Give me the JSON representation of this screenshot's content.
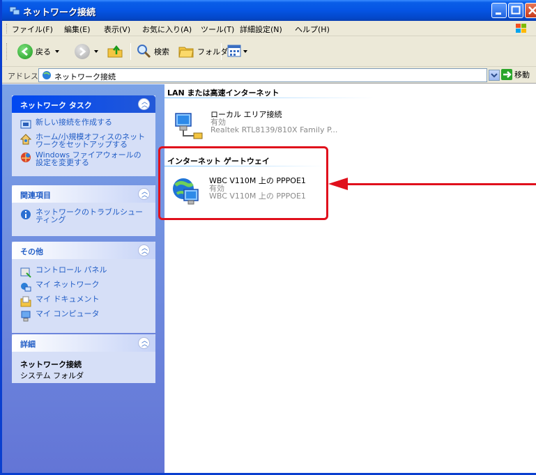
{
  "window": {
    "title": "ネットワーク接続",
    "menu": [
      "ファイル(F)",
      "編集(E)",
      "表示(V)",
      "お気に入り(A)",
      "ツール(T)",
      "詳細設定(N)",
      "ヘルプ(H)"
    ]
  },
  "toolbar": {
    "back_label": "戻る",
    "search_label": "検索",
    "folders_label": "フォルダ"
  },
  "address": {
    "label": "アドレス(D)",
    "value": "ネットワーク接続",
    "go_label": "移動"
  },
  "sidebar": {
    "network_tasks": {
      "title": "ネットワーク タスク",
      "items": [
        "新しい接続を作成する",
        "ホーム/小規模オフィスのネットワークをセットアップする",
        "Windows ファイアウォールの設定を変更する"
      ]
    },
    "related": {
      "title": "関連項目",
      "items": [
        "ネットワークのトラブルシューティング"
      ]
    },
    "other": {
      "title": "その他",
      "items": [
        "コントロール パネル",
        "マイ ネットワーク",
        "マイ ドキュメント",
        "マイ コンピュータ"
      ]
    },
    "details": {
      "title": "詳細",
      "name": "ネットワーク接続",
      "sub": "システム フォルダ"
    }
  },
  "content": {
    "groups": [
      {
        "title": "LAN または高速インターネット",
        "items": [
          {
            "name": "ローカル エリア接続",
            "status": "有効",
            "device": "Realtek RTL8139/810X Family P..."
          }
        ]
      },
      {
        "title": "インターネット ゲートウェイ",
        "items": [
          {
            "name": "WBC V110M 上の PPPOE1",
            "status": "有効",
            "device": "WBC V110M 上の PPPOE1"
          }
        ]
      }
    ]
  },
  "colors": {
    "annotation": "#e0101c",
    "link": "#215dc6"
  }
}
